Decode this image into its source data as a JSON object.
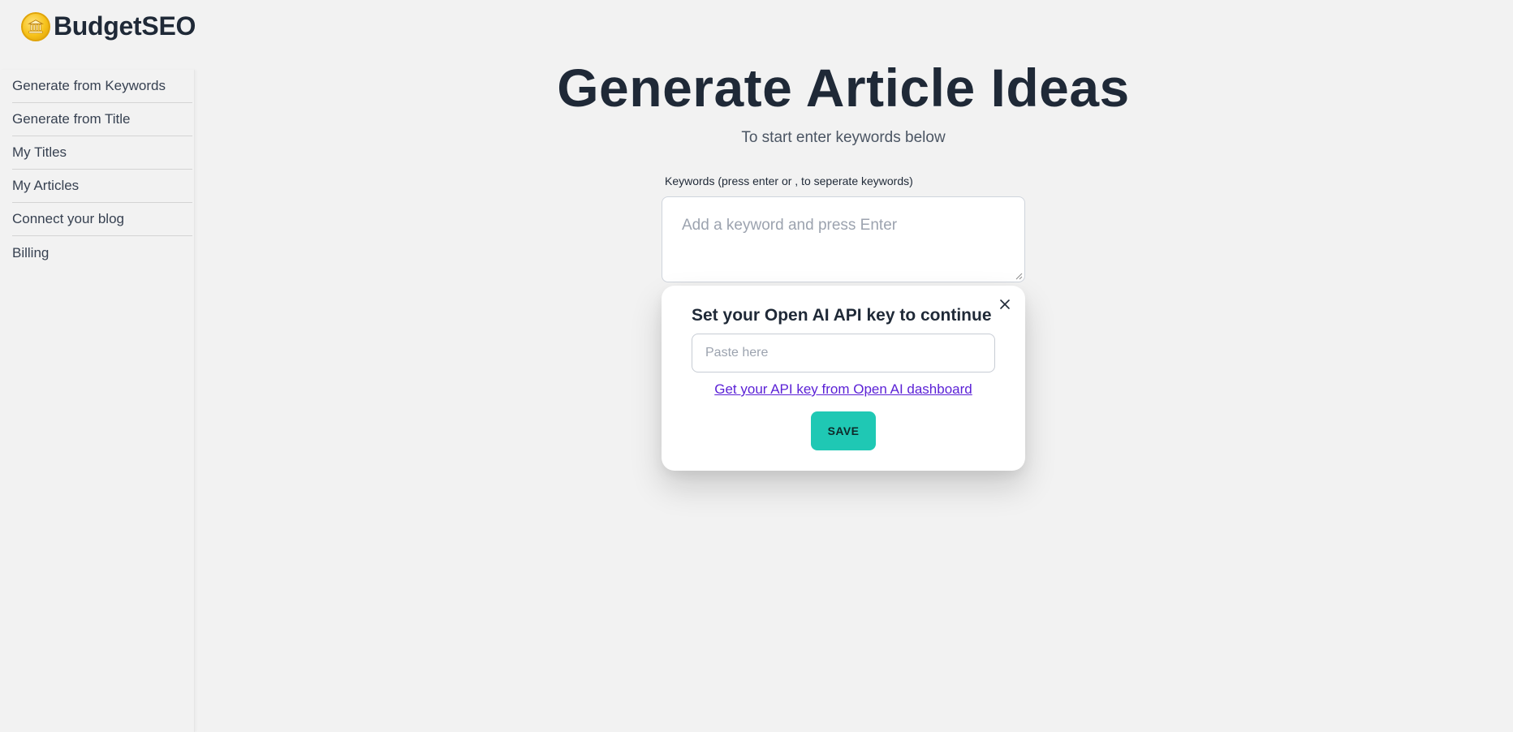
{
  "app": {
    "name": "BudgetSEO",
    "logo_icon": "coin-bank-icon"
  },
  "sidebar": {
    "items": [
      {
        "label": "Generate from Keywords"
      },
      {
        "label": "Generate from Title"
      },
      {
        "label": "My Titles"
      },
      {
        "label": "My Articles"
      },
      {
        "label": "Connect your blog"
      },
      {
        "label": "Billing"
      }
    ]
  },
  "main": {
    "title": "Generate Article Ideas",
    "subtitle": "To start enter keywords below",
    "keywords": {
      "label": "Keywords (press enter or , to seperate keywords)",
      "placeholder": "Add a keyword and press Enter",
      "value": ""
    }
  },
  "modal": {
    "title": "Set your Open AI API key to continue",
    "input_placeholder": "Paste here",
    "input_value": "",
    "link_text": "Get your API key from Open AI dashboard",
    "save_label": "SAVE",
    "close_icon": "close-icon"
  },
  "colors": {
    "background": "#f2f2f2",
    "accent": "#1fc8b4",
    "link": "#5b21d6",
    "text": "#1f2937"
  }
}
